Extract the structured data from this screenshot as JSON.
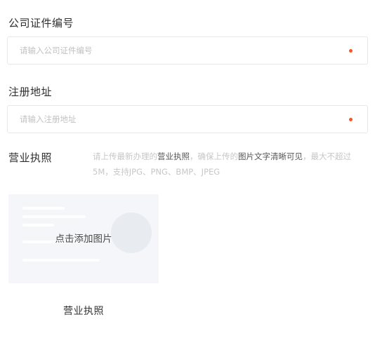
{
  "form": {
    "cert_number": {
      "label": "公司证件编号",
      "placeholder": "请输入公司证件编号",
      "value": ""
    },
    "reg_address": {
      "label": "注册地址",
      "placeholder": "请输入注册地址",
      "value": ""
    },
    "license": {
      "label": "营业执照",
      "hint_parts": {
        "p1": "请上传最新办理的",
        "p2": "营业执照",
        "p3": "，确保上传的",
        "p4": "图片文字清晰可见",
        "p5": "，最大不超过5M，支持JPG、PNG、BMP、JPEG"
      },
      "upload_text": "点击添加图片",
      "caption": "营业执照"
    }
  },
  "colors": {
    "required_dot": "#f05a24",
    "label_text": "#2f2f2f",
    "placeholder_text": "#c2c2c2",
    "upload_bg": "#f4f6f9"
  },
  "icons": {
    "required": "required-dot-icon"
  }
}
